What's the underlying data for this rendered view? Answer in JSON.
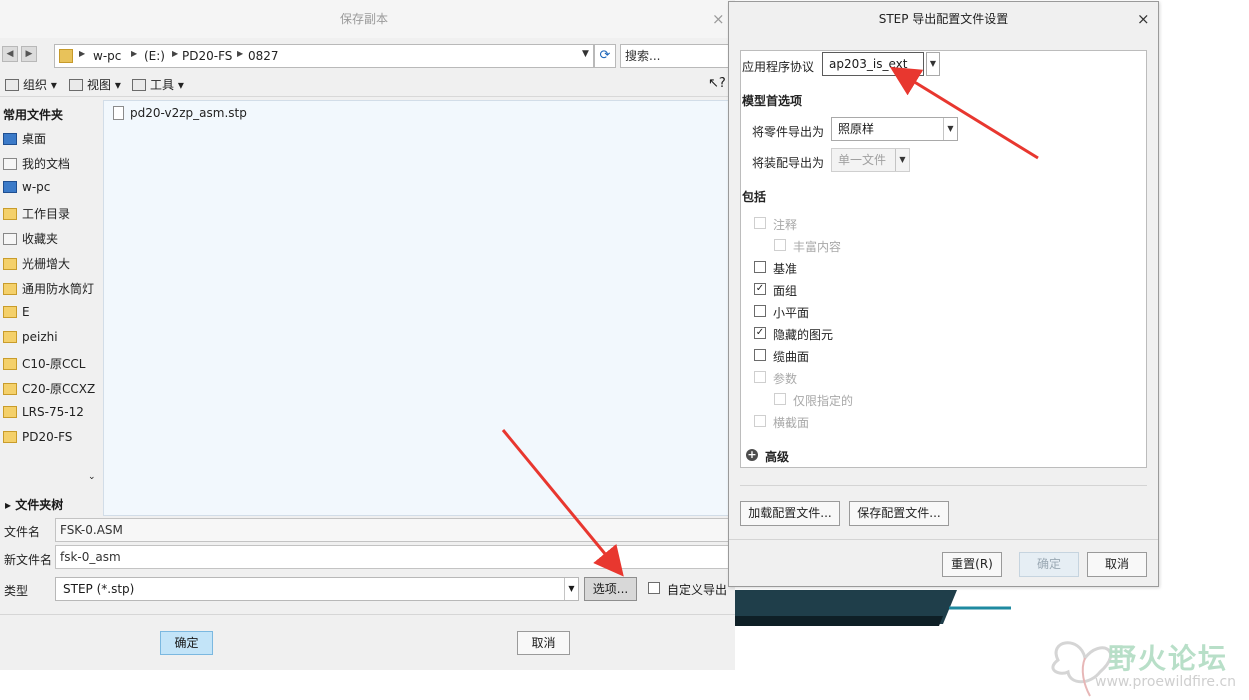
{
  "save_dialog": {
    "title": "保存副本",
    "close": "×",
    "address": [
      "w-pc",
      "(E:)",
      "PD20-FS",
      "0827"
    ],
    "search_placeholder": "搜索...",
    "toolbar": {
      "organize": "组织",
      "view": "视图",
      "tools": "工具"
    },
    "sidebar": {
      "title": "常用文件夹",
      "items": [
        "桌面",
        "我的文档",
        "w-pc",
        "工作目录",
        "收藏夹",
        "光栅增大",
        "通用防水筒灯",
        "E",
        "peizhi",
        "C10-原CCL",
        "C20-原CCXZ",
        "LRS-75-12",
        "PD20-FS"
      ],
      "folder_tree": "文件夹树"
    },
    "files": [
      "pd20-v2zp_asm.stp"
    ],
    "file_name_label": "文件名",
    "file_name_value": "FSK-0.ASM",
    "new_name_label": "新文件名",
    "new_name_value": "fsk-0_asm",
    "type_label": "类型",
    "type_value": "STEP (*.stp)",
    "options_button": "选项...",
    "custom_export_label": "自定义导出",
    "ok_button": "确定",
    "cancel_button": "取消"
  },
  "step_dialog": {
    "title": "STEP 导出配置文件设置",
    "close": "×",
    "protocol_label": "应用程序协议",
    "protocol_value": "ap203_is_ext",
    "model_prefs_title": "模型首选项",
    "part_export_label": "将零件导出为",
    "part_export_value": "照原样",
    "assembly_export_label": "将装配导出为",
    "assembly_export_value": "单一文件",
    "include_title": "包括",
    "include": [
      {
        "label": "注释",
        "checked": false,
        "enabled": false
      },
      {
        "label": "丰富内容",
        "checked": false,
        "enabled": false
      },
      {
        "label": "基准",
        "checked": false,
        "enabled": true
      },
      {
        "label": "面组",
        "checked": true,
        "enabled": true
      },
      {
        "label": "小平面",
        "checked": false,
        "enabled": true
      },
      {
        "label": "隐藏的图元",
        "checked": true,
        "enabled": true
      },
      {
        "label": "缆曲面",
        "checked": false,
        "enabled": true
      },
      {
        "label": "参数",
        "checked": false,
        "enabled": false
      },
      {
        "label": "仅限指定的",
        "checked": false,
        "enabled": false
      },
      {
        "label": "横截面",
        "checked": false,
        "enabled": false
      }
    ],
    "advanced_label": "高级",
    "load_config_button": "加载配置文件...",
    "save_config_button": "保存配置文件...",
    "reset_button": "重置(R)",
    "ok_button": "确定",
    "cancel_button": "取消"
  },
  "watermark": {
    "text": "野火论坛",
    "url": "www.proewildfire.cn"
  },
  "colors": {
    "annotation_arrow": "#e8372f",
    "ok_button_bg": "#c3e4f8",
    "file_pane_bg": "#f2f8fd"
  }
}
